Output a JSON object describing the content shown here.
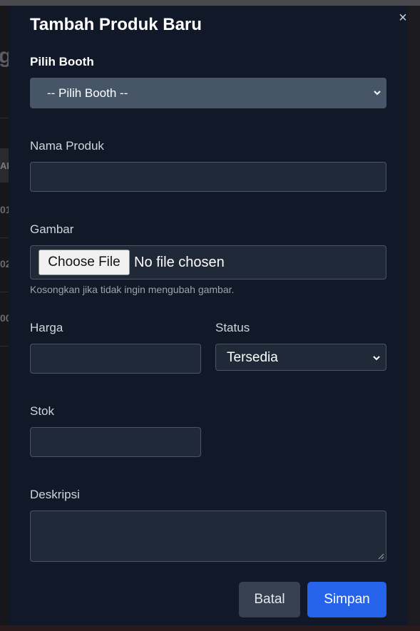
{
  "modal": {
    "title": "Tambah Produk Baru",
    "close_glyph": "×",
    "booth": {
      "label": "Pilih Booth",
      "selected": "-- Pilih Booth --"
    },
    "name": {
      "label": "Nama Produk",
      "value": ""
    },
    "image": {
      "label": "Gambar",
      "button": "Choose File",
      "status": "No file chosen",
      "hint": "Kosongkan jika tidak ingin mengubah gambar."
    },
    "price": {
      "label": "Harga",
      "value": ""
    },
    "status": {
      "label": "Status",
      "selected": "Tersedia"
    },
    "stock": {
      "label": "Stok",
      "value": ""
    },
    "description": {
      "label": "Deskripsi",
      "value": ""
    },
    "buttons": {
      "cancel": "Batal",
      "save": "Simpan"
    }
  },
  "background": {
    "heading_fragment": "g",
    "column_header_fragment": "AR",
    "row_fragments": [
      "01",
      "02",
      "00"
    ]
  },
  "colors": {
    "modal_bg": "#111827",
    "field_bg": "#1f2937",
    "select_bg": "#475569",
    "primary": "#2563eb",
    "secondary": "#374151"
  }
}
